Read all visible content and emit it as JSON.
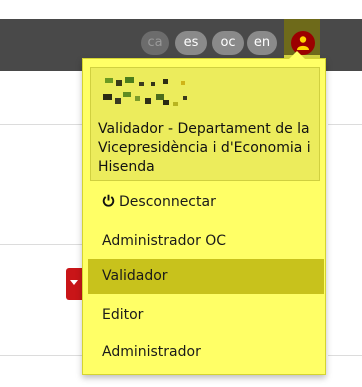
{
  "header": {
    "languages": [
      {
        "code": "ca",
        "active": true
      },
      {
        "code": "es",
        "active": false
      },
      {
        "code": "oc",
        "active": false
      },
      {
        "code": "en",
        "active": false
      }
    ],
    "user_icon": "user-icon"
  },
  "user_menu": {
    "user_role": "Validador - Departament de la Vicepresidència i d'Economia i Hisenda",
    "items": [
      {
        "label": "Desconnectar",
        "icon": "power-icon"
      },
      {
        "label": "Administrador OC"
      },
      {
        "label": "Validador",
        "selected": true
      },
      {
        "label": "Editor"
      },
      {
        "label": "Administrador"
      }
    ]
  },
  "colors": {
    "header_bg": "#494949",
    "menu_bg": "#ffff66",
    "selected_bg": "#c8c21c",
    "user_avatar_bg": "#9b0000"
  }
}
